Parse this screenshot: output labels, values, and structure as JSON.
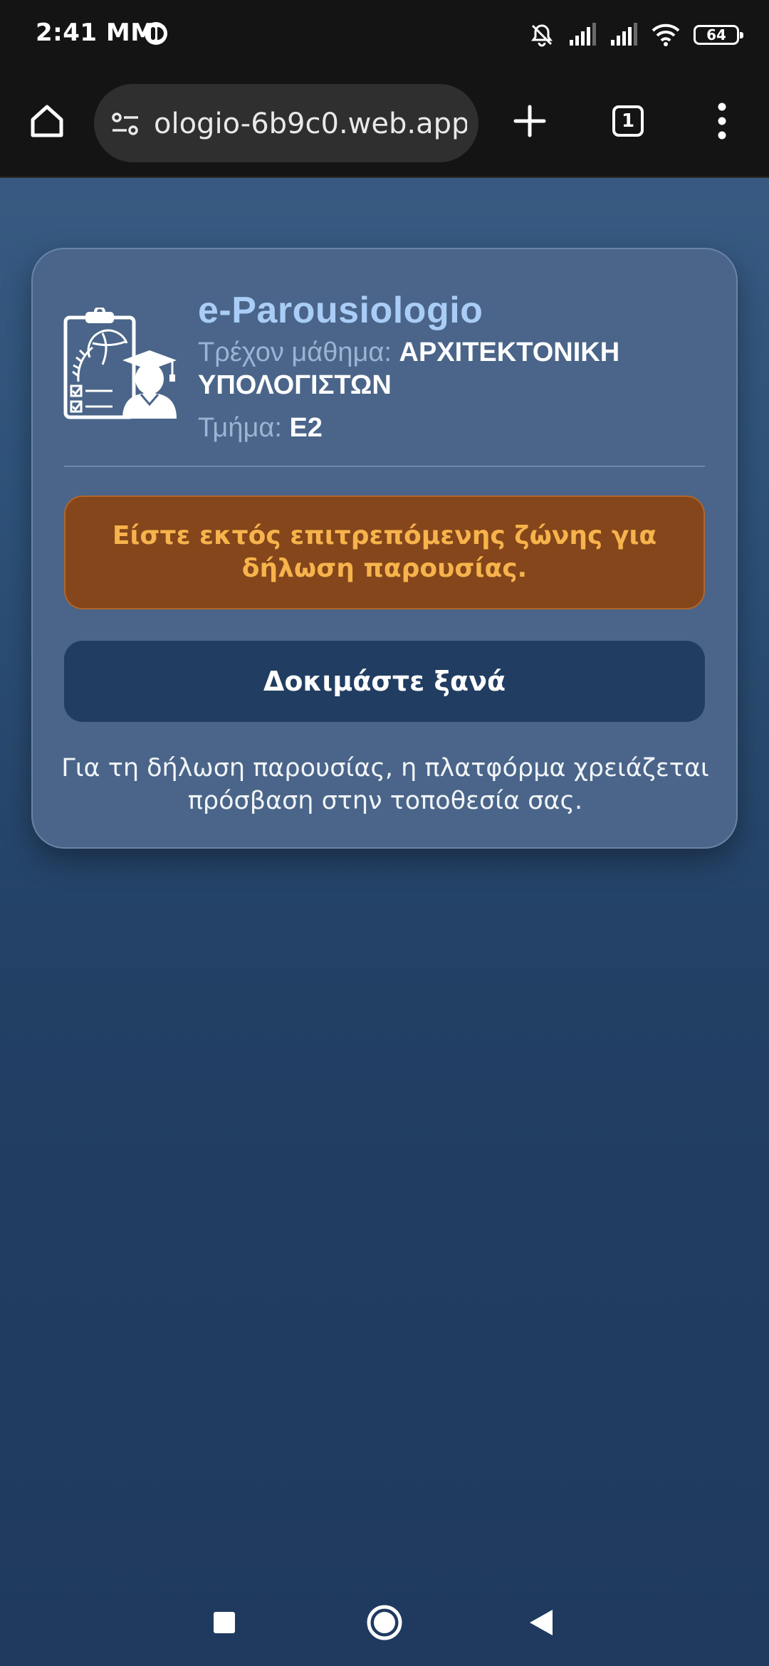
{
  "status_bar": {
    "time": "2:41 MM",
    "battery": "64",
    "icons": [
      "notifications-muted-icon",
      "signal-icon",
      "signal-icon",
      "wifi-icon",
      "battery-icon"
    ]
  },
  "browser": {
    "url": "ologio-6b9c0.web.app",
    "tab_count": "1",
    "icons": [
      "home-icon",
      "site-settings-icon",
      "new-tab-plus-icon",
      "tab-switcher-icon",
      "more-vertical-icon"
    ]
  },
  "card": {
    "logo_icon": "attendance-clipboard-graduate-icon",
    "title": "e-Parousiologio",
    "course_label": "Τρέχον μάθημα:",
    "course_value": "ΑΡΧΙΤΕΚΤΟΝΙΚΗ",
    "course_value_2": "ΥΠΟΛΟΓΙΣΤΩΝ",
    "section_label": "Τμήμα:",
    "section_value": "Ε2",
    "alert": "Είστε εκτός επιτρεπόμενης ζώνης για δήλωση παρουσίας.",
    "retry_button": "Δοκιμάστε ξανά",
    "hint": "Για τη δήλωση παρουσίας, η πλατφόρμα χρειάζεται πρόσβαση στην τοποθεσία σας."
  },
  "colors": {
    "title": "#a9cdf6",
    "alert_bg": "#84461a",
    "alert_text": "#f7b34c",
    "button_bg": "#213d61",
    "card_bg": "#4a6589"
  },
  "nav": {
    "icons": [
      "recents-square-icon",
      "home-circle-icon",
      "back-triangle-icon"
    ]
  }
}
